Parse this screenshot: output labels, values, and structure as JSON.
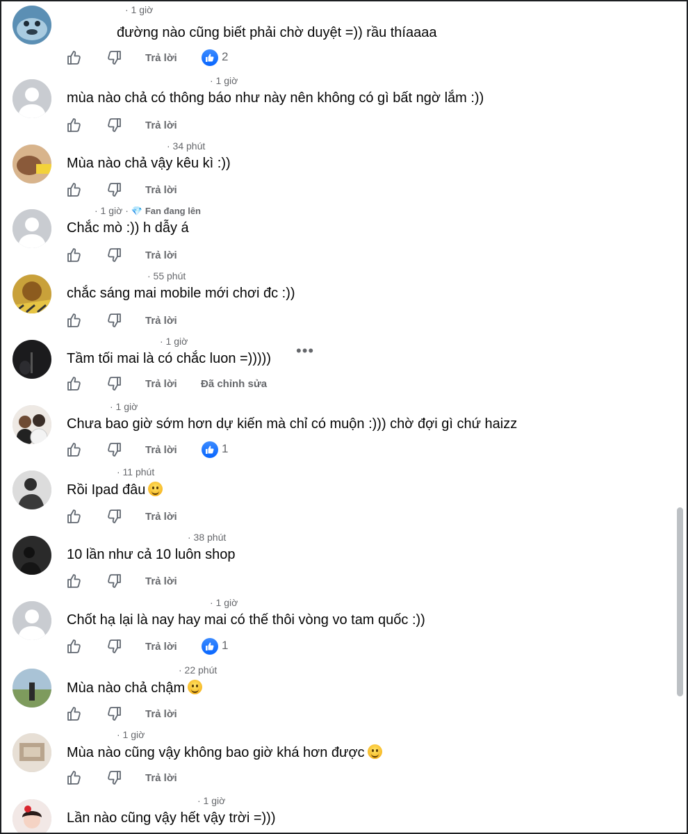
{
  "colors": {
    "text": "#050505",
    "secondary": "#65676b",
    "like_blue": "#0866ff",
    "avatar_default": "#c9ccd1"
  },
  "labels": {
    "like_icon": "like-icon",
    "dislike_icon": "dislike-icon",
    "reply": "Trả lời",
    "edited": "Đã chỉnh sửa"
  },
  "comments": [
    {
      "time": "· 1 giờ",
      "text": "đường nào cũng biết phải chờ duyệt =)) rầu thíaaaa",
      "reactions": "2"
    },
    {
      "time": "· 1 giờ",
      "text": "mùa nào chả có thông báo như này nên không có gì bất ngờ lắm :))"
    },
    {
      "time": "· 34 phút",
      "text": "Mùa nào chả vậy kêu kì :))"
    },
    {
      "time": "· 1 giờ ·",
      "badge": "Fan đang lên",
      "text": "Chắc mò :)) h dẫy á"
    },
    {
      "time": "· 55 phút",
      "text": "chắc sáng mai mobile mới chơi đc :))"
    },
    {
      "time": "· 1 giờ",
      "text": "Tầm tối mai là có chắc luon =)))))",
      "more": "•••"
    },
    {
      "time": "· 1 giờ",
      "text": "Chưa bao giờ sớm hơn dự kiến mà chỉ có muộn :))) chờ đợi gì chứ haizz",
      "reactions": "1"
    },
    {
      "time": "· 11 phút",
      "text": "Rồi Ipad đâu"
    },
    {
      "time": "· 38 phút",
      "text": "10 lần như cả 10 luôn shop"
    },
    {
      "time": "· 1 giờ",
      "text": "Chốt hạ lại là nay hay mai có thế thôi vòng vo tam quốc :))",
      "reactions": "1"
    },
    {
      "time": "· 22 phút",
      "text": "Mùa nào chả chậm"
    },
    {
      "time": "· 1 giờ",
      "text": "Mùa nào cũng vậy không bao giờ khá hơn được"
    },
    {
      "time": "· 1 giờ",
      "text": "Lần nào cũng vậy hết vậy trời =)))"
    }
  ]
}
